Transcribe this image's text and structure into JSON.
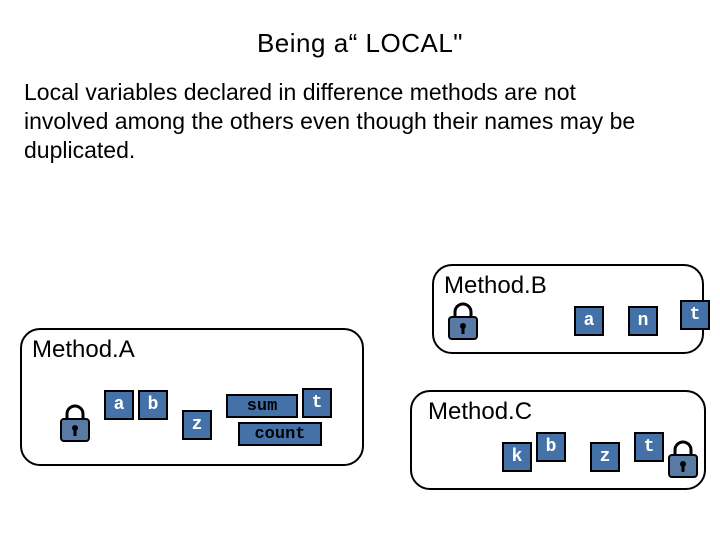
{
  "title": "Being a“ LOCAL\"",
  "intro": "Local variables declared in difference methods are not involved among the others even though their names may be duplicated.",
  "methods": {
    "A": {
      "title": "Method.A",
      "vars": {
        "a": "a",
        "b": "b",
        "z": "z",
        "sum": "sum",
        "t": "t",
        "count": "count"
      }
    },
    "B": {
      "title": "Method.B",
      "vars": {
        "a": "a",
        "n": "n",
        "t": "t"
      }
    },
    "C": {
      "title": "Method.C",
      "vars": {
        "k": "k",
        "b": "b",
        "z": "z",
        "t": "t"
      }
    }
  }
}
